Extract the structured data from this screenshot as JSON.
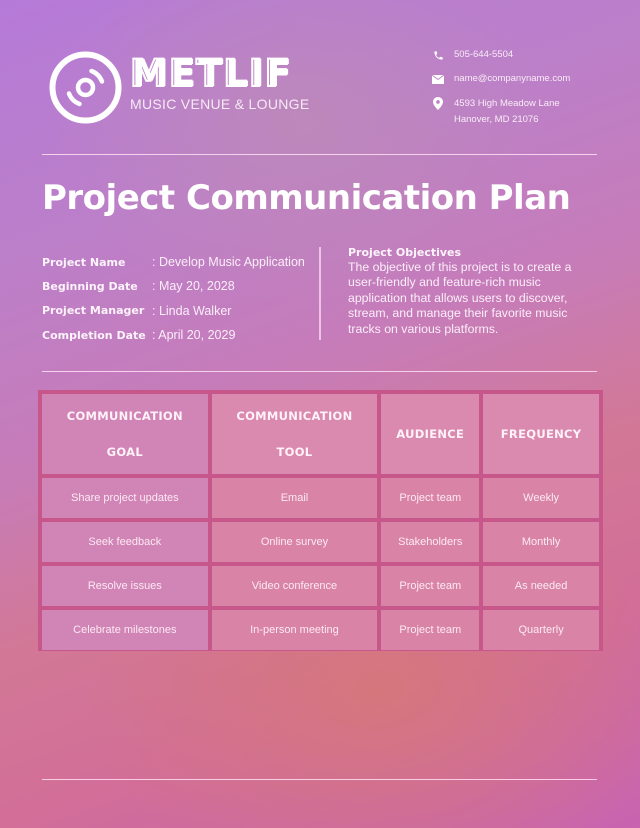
{
  "brand": {
    "logo_icon": "vinyl-disc-icon",
    "name": "METLIF",
    "subtitle": "MUSIC VENUE & LOUNGE"
  },
  "contact": {
    "phone": "505-644-5504",
    "email": "name@companyname.com",
    "address_line1": "4593 High Meadow Lane",
    "address_line2": "Hanover, MD 21076",
    "icons": [
      "phone-icon",
      "mail-icon",
      "location-pin-icon"
    ]
  },
  "title": "Project Communication Plan",
  "project_info": [
    {
      "label": "Project Name",
      "value": ": Develop Music Application"
    },
    {
      "label": "Beginning Date",
      "value": ": May 20, 2028"
    },
    {
      "label": "Project Manager",
      "value": ": Linda Walker"
    },
    {
      "label": "Completion Date",
      "value": ": April 20, 2029"
    }
  ],
  "objectives": {
    "title": "Project Objectives",
    "text": "The objective of this project is to create a user-friendly and feature-rich music application that allows users to discover, stream, and manage their favorite music tracks on various platforms."
  },
  "table": {
    "headers": [
      {
        "line1": "COMMUNICATION",
        "line2": "GOAL"
      },
      {
        "line1": "COMMUNICATION",
        "line2": "TOOL"
      },
      {
        "line1": "AUDIENCE",
        "line2": ""
      },
      {
        "line1": "FREQUENCY",
        "line2": ""
      }
    ],
    "rows": [
      [
        "Share project updates",
        "Email",
        "Project team",
        "Weekly"
      ],
      [
        "Seek feedback",
        "Online survey",
        "Stakeholders",
        "Monthly"
      ],
      [
        "Resolve issues",
        "Video conference",
        "Project team",
        "As needed"
      ],
      [
        "Celebrate milestones",
        "In-person meeting",
        "Project team",
        "Quarterly"
      ]
    ]
  }
}
